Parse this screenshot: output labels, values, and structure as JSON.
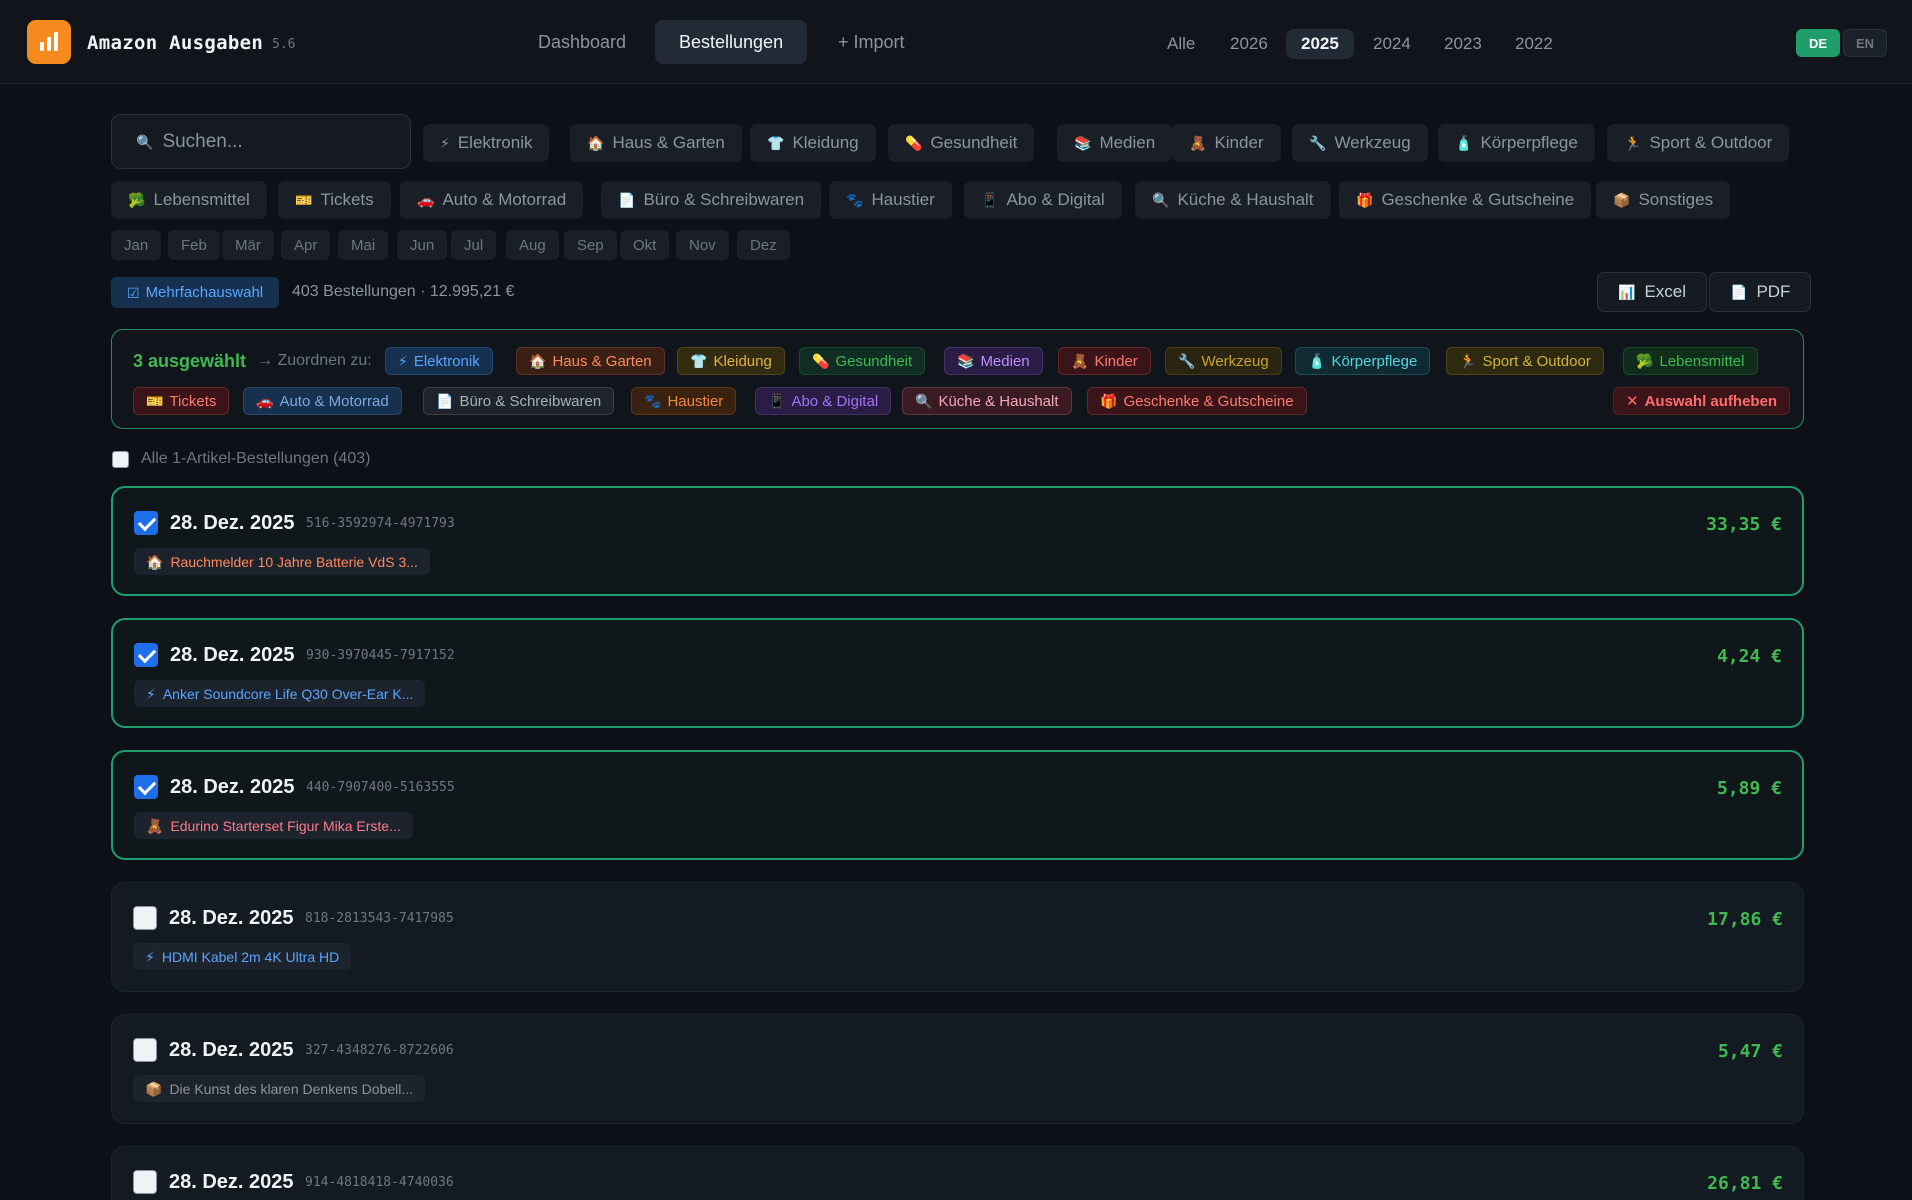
{
  "app": {
    "title": "Amazon Ausgaben",
    "version": "5.6"
  },
  "nav": {
    "tabs": [
      {
        "label": "Dashboard"
      },
      {
        "label": "Bestellungen"
      },
      {
        "label": "+ Import"
      }
    ]
  },
  "years": [
    {
      "label": "Alle"
    },
    {
      "label": "2026"
    },
    {
      "label": "2025"
    },
    {
      "label": "2024"
    },
    {
      "label": "2023"
    },
    {
      "label": "2022"
    }
  ],
  "lang": {
    "de": "DE",
    "en": "EN"
  },
  "search": {
    "placeholder": "Suchen..."
  },
  "categories": [
    {
      "label": "Elektronik",
      "icon": "lightning-icon",
      "glyph": "⚡"
    },
    {
      "label": "Haus & Garten",
      "icon": "house-icon",
      "glyph": "🏠"
    },
    {
      "label": "Kleidung",
      "icon": "shirt-icon",
      "glyph": "👕"
    },
    {
      "label": "Gesundheit",
      "icon": "pill-icon",
      "glyph": "💊"
    },
    {
      "label": "Medien",
      "icon": "books-icon",
      "glyph": "📚"
    },
    {
      "label": "Kinder",
      "icon": "teddy-bear-icon",
      "glyph": "🧸"
    },
    {
      "label": "Werkzeug",
      "icon": "wrench-icon",
      "glyph": "🔧"
    },
    {
      "label": "Körperpflege",
      "icon": "lotion-bottle-icon",
      "glyph": "🧴"
    },
    {
      "label": "Sport & Outdoor",
      "icon": "runner-icon",
      "glyph": "🏃"
    },
    {
      "label": "Lebensmittel",
      "icon": "broccoli-icon",
      "glyph": "🥦"
    },
    {
      "label": "Tickets",
      "icon": "ticket-icon",
      "glyph": "🎫"
    },
    {
      "label": "Auto & Motorrad",
      "icon": "car-icon",
      "glyph": "🚗"
    },
    {
      "label": "Büro & Schreibwaren",
      "icon": "document-icon",
      "glyph": "📄"
    },
    {
      "label": "Haustier",
      "icon": "paw-icon",
      "glyph": "🐾"
    },
    {
      "label": "Abo & Digital",
      "icon": "phone-icon",
      "glyph": "📱"
    },
    {
      "label": "Küche & Haushalt",
      "icon": "magnifier-icon",
      "glyph": "🔍"
    },
    {
      "label": "Geschenke & Gutscheine",
      "icon": "gift-icon",
      "glyph": "🎁"
    },
    {
      "label": "Sonstiges",
      "icon": "package-icon",
      "glyph": "📦"
    }
  ],
  "months": [
    "Jan",
    "Feb",
    "Mär",
    "Apr",
    "Mai",
    "Jun",
    "Jul",
    "Aug",
    "Sep",
    "Okt",
    "Nov",
    "Dez"
  ],
  "toolbar": {
    "multi_label": "Mehrfachauswahl",
    "summary": "403 Bestellungen · 12.995,21 €",
    "excel": "Excel",
    "pdf": "PDF"
  },
  "assign": {
    "count": "3 ausgewählt",
    "to": "→ Zuordnen zu:",
    "clear": "Auswahl aufheben"
  },
  "colors": {
    "accent_green": "#3fb950",
    "selected_border": "#1f9d6a",
    "checkbox_blue": "#1f6feb",
    "logo_orange": "#f58a1f"
  },
  "select_all": "Alle 1-Artikel-Bestellungen (403)",
  "orders": [
    {
      "date": "28. Dez. 2025",
      "id": "516-3592974-4971793",
      "amount": "33,35 €",
      "selected": true,
      "item": {
        "glyph": "🏠",
        "icon": "house-icon",
        "label": "Rauchmelder 10 Jahre Batterie VdS 3...",
        "color": "#ff8a5c"
      }
    },
    {
      "date": "28. Dez. 2025",
      "id": "930-3970445-7917152",
      "amount": "4,24 €",
      "selected": true,
      "item": {
        "glyph": "⚡",
        "icon": "lightning-icon",
        "label": "Anker Soundcore Life Q30 Over-Ear K...",
        "color": "#58a6ff"
      }
    },
    {
      "date": "28. Dez. 2025",
      "id": "440-7907400-5163555",
      "amount": "5,89 €",
      "selected": true,
      "item": {
        "glyph": "🧸",
        "icon": "teddy-bear-icon",
        "label": "Edurino Starterset Figur Mika Erste...",
        "color": "#ff7b8a"
      }
    },
    {
      "date": "28. Dez. 2025",
      "id": "818-2813543-7417985",
      "amount": "17,86 €",
      "selected": false,
      "item": {
        "glyph": "⚡",
        "icon": "lightning-icon",
        "label": "HDMI Kabel 2m 4K Ultra HD",
        "color": "#58a6ff"
      }
    },
    {
      "date": "28. Dez. 2025",
      "id": "327-4348276-8722606",
      "amount": "5,47 €",
      "selected": false,
      "item": {
        "glyph": "📦",
        "icon": "package-icon",
        "label": "Die Kunst des klaren Denkens Dobell...",
        "color": "#8b949e"
      }
    },
    {
      "date": "28. Dez. 2025",
      "id": "914-4818418-4740036",
      "amount": "26,81 €",
      "selected": false,
      "item": null
    }
  ]
}
